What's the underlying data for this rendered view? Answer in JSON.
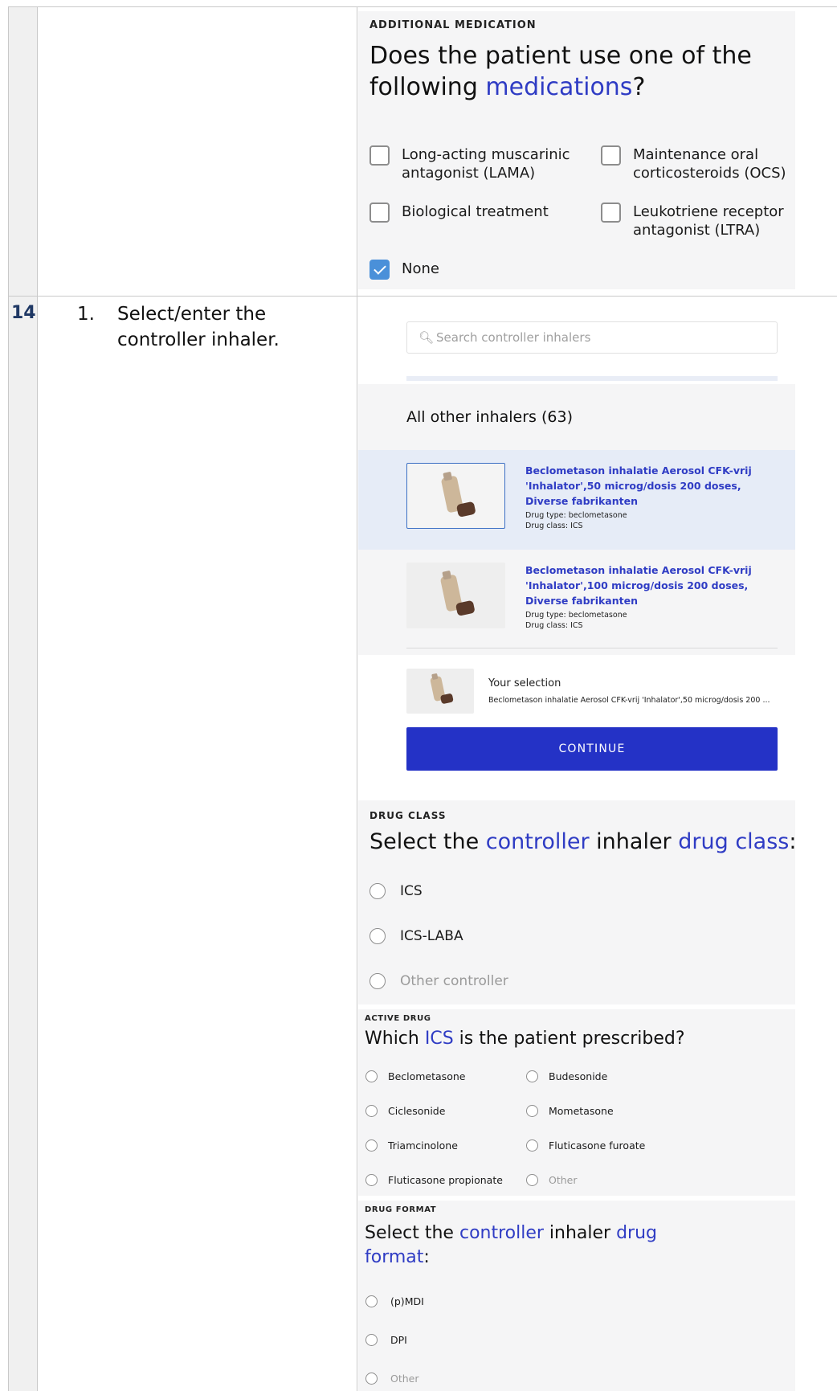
{
  "row": {
    "number": "14",
    "step_number": "1.",
    "step_text": "Select/enter the controller inhaler."
  },
  "additional_medication": {
    "eyebrow": "ADDITIONAL MEDICATION",
    "question_pre": "Does the patient use one of the following ",
    "question_hl": "medications",
    "question_post": "?",
    "options": [
      {
        "label": "Long-acting muscarinic antagonist (LAMA)",
        "checked": false
      },
      {
        "label": "Maintenance oral corticosteroids (OCS)",
        "checked": false
      },
      {
        "label": "Biological treatment",
        "checked": false
      },
      {
        "label": "Leukotriene receptor antagonist (LTRA)",
        "checked": false
      },
      {
        "label": "None",
        "checked": true
      }
    ]
  },
  "inhaler_search": {
    "placeholder": "Search controller inhalers",
    "section_title": "All other inhalers (63)",
    "items": [
      {
        "name": "Beclometason inhalatie Aerosol CFK-vrij 'Inhalator',50 microg/dosis 200 doses, Diverse fabrikanten",
        "drug_type": "Drug type: beclometasone",
        "drug_class": "Drug class: ICS",
        "selected": true
      },
      {
        "name": "Beclometason inhalatie Aerosol CFK-vrij 'Inhalator',100 microg/dosis 200 doses, Diverse fabrikanten",
        "drug_type": "Drug type: beclometasone",
        "drug_class": "Drug class: ICS",
        "selected": false
      }
    ],
    "selection_label": "Your selection",
    "selection_value": "Beclometason inhalatie Aerosol CFK-vrij 'Inhalator',50 microg/dosis 200 ...",
    "continue_label": "CONTINUE"
  },
  "drug_class": {
    "eyebrow": "DRUG CLASS",
    "q_1": "Select the ",
    "q_2": "controller",
    "q_3": " inhaler ",
    "q_4": "drug class",
    "q_5": ":",
    "options": [
      "ICS",
      "ICS-LABA",
      "Other controller"
    ]
  },
  "active_drug": {
    "eyebrow": "ACTIVE DRUG",
    "q_1": "Which ",
    "q_2": "ICS",
    "q_3": " is the patient prescribed?",
    "options": [
      "Beclometasone",
      "Budesonide",
      "Ciclesonide",
      "Mometasone",
      "Triamcinolone",
      "Fluticasone furoate",
      "Fluticasone propionate",
      "Other"
    ]
  },
  "drug_format": {
    "eyebrow": "DRUG FORMAT",
    "q_1": "Select the ",
    "q_2": "controller",
    "q_3": " inhaler ",
    "q_4": "drug format",
    "q_5": ":",
    "options": [
      "(p)MDI",
      "DPI",
      "Other"
    ]
  },
  "colors": {
    "accent": "#2f3cc4",
    "button": "#2432c6",
    "checkbox_checked": "#4a90d9",
    "selected_row": "#e6ecf7",
    "row_number": "#1f3864"
  }
}
